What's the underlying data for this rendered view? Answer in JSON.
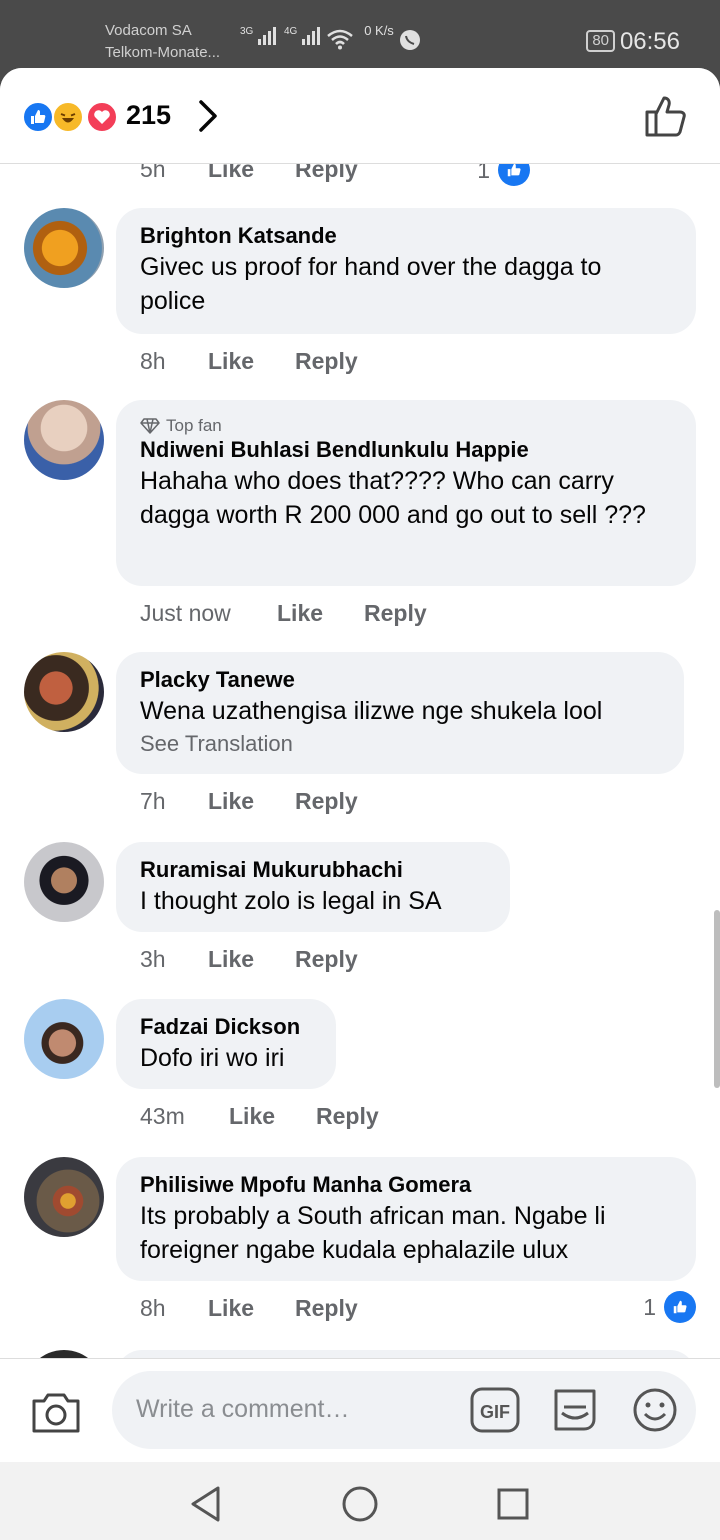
{
  "status": {
    "carrier1": "Vodacom SA",
    "carrier2": "Telkom-Monate...",
    "sig1": "3G",
    "sig2": "4G",
    "speed": "0 K/s",
    "battery": "80",
    "time": "06:56"
  },
  "header": {
    "reaction_count": "215"
  },
  "partial_top": {
    "time": "5h",
    "like": "Like",
    "reply": "Reply",
    "count": "1"
  },
  "comments": [
    {
      "name": "Brighton Katsande",
      "text": "Givec us proof for hand over the dagga to police",
      "time": "8h",
      "like": "Like",
      "reply": "Reply"
    },
    {
      "badge": "Top fan",
      "name": "Ndiweni Buhlasi Bendlunkulu Happie",
      "text": "Hahaha who does that???? Who can carry dagga worth R 200 000 and go out to sell ???",
      "time": "Just now",
      "like": "Like",
      "reply": "Reply"
    },
    {
      "name": "Placky Tanewe",
      "text": "Wena uzathengisa ilizwe nge shukela lool",
      "see_translation": "See Translation",
      "time": "7h",
      "like": "Like",
      "reply": "Reply"
    },
    {
      "name": "Ruramisai Mukurubhachi",
      "text": "I thought zolo is legal in SA",
      "time": "3h",
      "like": "Like",
      "reply": "Reply"
    },
    {
      "name": "Fadzai Dickson",
      "text": "Dofo iri wo iri",
      "time": "43m",
      "like": "Like",
      "reply": "Reply"
    },
    {
      "name": "Philisiwe Mpofu Manha Gomera",
      "text": "Its probably a South african man. Ngabe li foreigner ngabe kudala ephalazile ulux",
      "time": "8h",
      "like": "Like",
      "reply": "Reply",
      "reaction_count": "1"
    }
  ],
  "composer": {
    "placeholder": "Write a comment…"
  },
  "colors": {
    "accent": "#1877f2",
    "bubble": "#f0f2f5",
    "meta_text": "#65676b"
  }
}
